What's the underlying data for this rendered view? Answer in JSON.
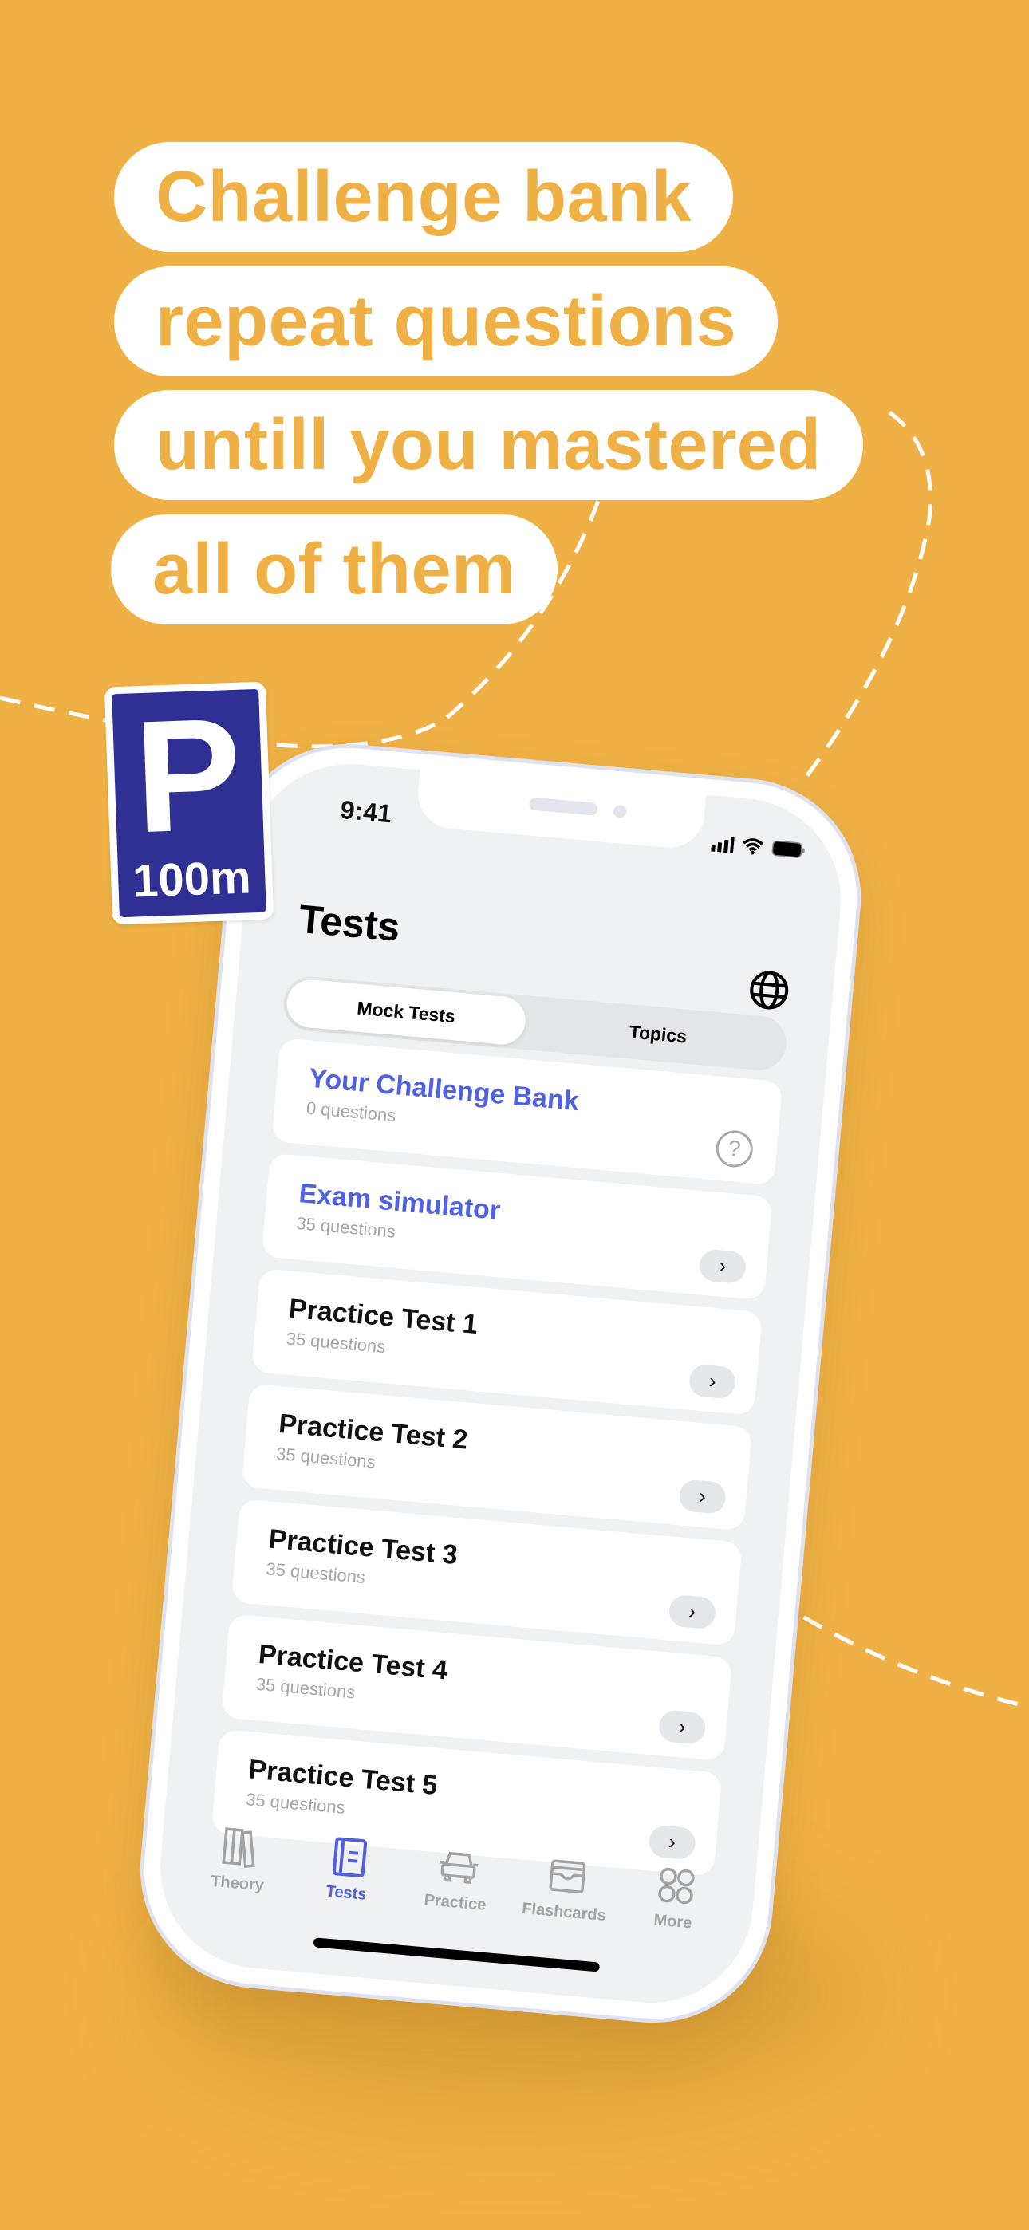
{
  "headline": [
    "Challenge bank",
    "repeat questions",
    "untill you mastered",
    "all of them"
  ],
  "sign": {
    "letter": "P",
    "distance": "100m"
  },
  "colors": {
    "background": "#efb145",
    "accent": "#5062e0",
    "sign": "#2f2f94"
  },
  "status": {
    "time": "9:41"
  },
  "screen": {
    "title": "Tests",
    "globe_icon": "globe-icon",
    "segments": {
      "active": "Mock Tests",
      "inactive": "Topics"
    },
    "cards": [
      {
        "name": "Your Challenge Bank",
        "sub": "0 questions",
        "highlight": true,
        "icon": "help-icon"
      },
      {
        "name": "Exam simulator",
        "sub": "35 questions",
        "highlight": true,
        "icon": "chevron-right-icon"
      },
      {
        "name": "Practice Test 1",
        "sub": "35 questions",
        "highlight": false,
        "icon": "chevron-right-icon"
      },
      {
        "name": "Practice Test 2",
        "sub": "35 questions",
        "highlight": false,
        "icon": "chevron-right-icon"
      },
      {
        "name": "Practice Test 3",
        "sub": "35 questions",
        "highlight": false,
        "icon": "chevron-right-icon"
      },
      {
        "name": "Practice Test 4",
        "sub": "35 questions",
        "highlight": false,
        "icon": "chevron-right-icon"
      },
      {
        "name": "Practice Test 5",
        "sub": "35 questions",
        "highlight": false,
        "icon": "chevron-right-icon"
      }
    ],
    "chevron": "›",
    "help": "?"
  },
  "tabs": [
    {
      "label": "Theory",
      "icon": "books-icon",
      "active": false
    },
    {
      "label": "Tests",
      "icon": "notebook-icon",
      "active": true
    },
    {
      "label": "Practice",
      "icon": "car-icon",
      "active": false
    },
    {
      "label": "Flashcards",
      "icon": "card-box-icon",
      "active": false
    },
    {
      "label": "More",
      "icon": "four-circles-icon",
      "active": false
    }
  ]
}
